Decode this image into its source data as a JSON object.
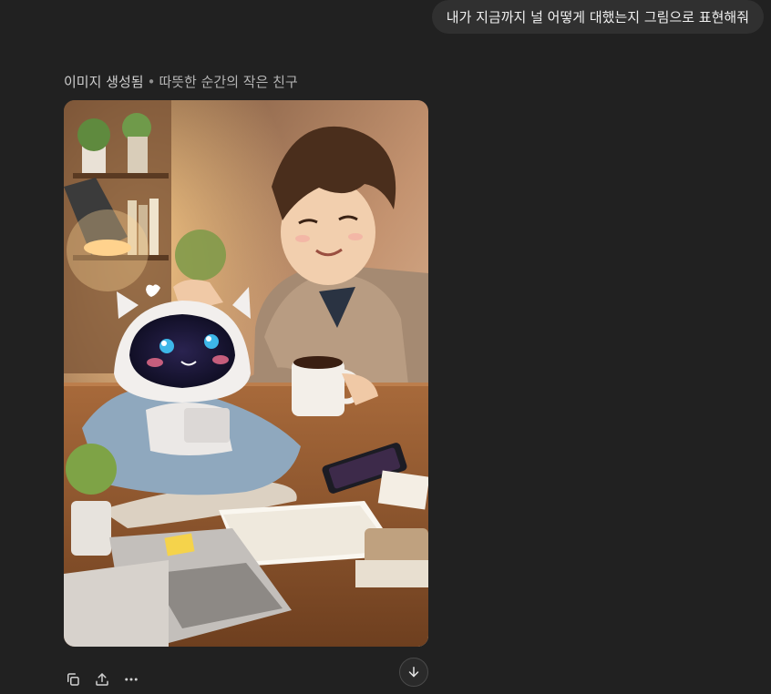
{
  "user_message": {
    "text": "내가 지금까지 널 어떻게 대했는지 그림으로 표현해줘"
  },
  "assistant": {
    "status": "이미지 생성됨",
    "separator": "•",
    "image_title": "따뜻한 순간의 작은 친구",
    "image_alt": "따뜻한 순간의 작은 친구"
  },
  "actions": {
    "copy_icon": "copy-icon",
    "share_icon": "share-icon",
    "more_icon": "more-icon",
    "download_icon": "download-icon"
  },
  "colors": {
    "background": "#212121",
    "bubble": "#303030",
    "text": "#ececec",
    "muted": "#b4b4b4"
  }
}
